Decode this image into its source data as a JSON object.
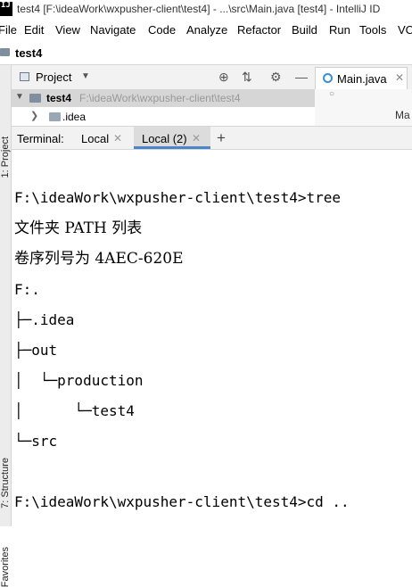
{
  "window": {
    "title": "test4 [F:\\ideaWork\\wxpusher-client\\test4] - ...\\src\\Main.java [test4] - IntelliJ ID",
    "app_icon_text": "IJ"
  },
  "menu": [
    {
      "label": "File"
    },
    {
      "label": "Edit"
    },
    {
      "label": "View"
    },
    {
      "label": "Navigate"
    },
    {
      "label": "Code"
    },
    {
      "label": "Analyze"
    },
    {
      "label": "Refactor"
    },
    {
      "label": "Build"
    },
    {
      "label": "Run"
    },
    {
      "label": "Tools"
    },
    {
      "label": "VC"
    }
  ],
  "navbar": {
    "project": "test4"
  },
  "left_stripe": {
    "project": "1: Project",
    "structure": "7: Structure",
    "favorites": "Favorites"
  },
  "project_panel": {
    "title": "Project",
    "tree": {
      "root_name": "test4",
      "root_path": "F:\\ideaWork\\wxpusher-client\\test4",
      "child_name": ".idea"
    }
  },
  "editor": {
    "tab_label": "Main.java",
    "crumb": "Ma"
  },
  "terminal": {
    "title": "Terminal:",
    "tabs": [
      {
        "label": "Local"
      },
      {
        "label": "Local (2)"
      }
    ],
    "lines": [
      "F:\\ideaWork\\wxpusher-client\\test4>tree",
      "文件夹 PATH 列表",
      "卷序列号为 4AEC-620E",
      "F:.",
      "├─.idea",
      "├─out",
      "│  └─production",
      "│      └─test4",
      "└─src",
      "",
      "F:\\ideaWork\\wxpusher-client\\test4>cd .."
    ]
  },
  "icons": {
    "app": "intellij-icon",
    "folder": "folder-icon",
    "locate": "crosshair-icon",
    "collapse": "collapse-all-icon",
    "settings": "gear-icon",
    "minimize": "minus-icon",
    "java_class": "java-class-icon",
    "close": "close-icon",
    "add": "plus-icon"
  },
  "colors": {
    "selected_row": "#d6d6d6",
    "active_tab_underline": "#4a86c8",
    "java_icon": "#3a8fd8"
  }
}
